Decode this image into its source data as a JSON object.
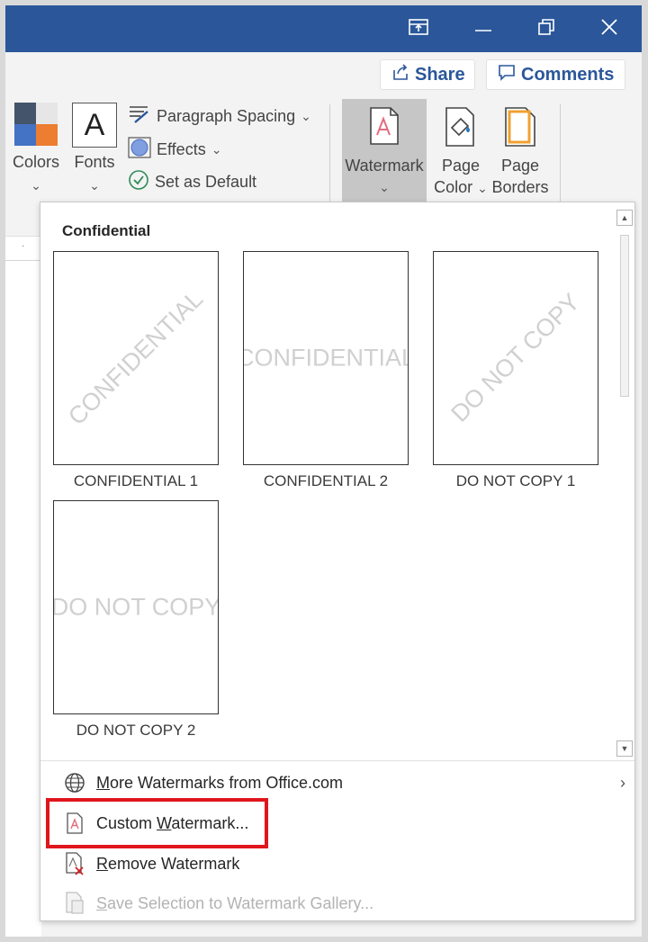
{
  "titlebar": {
    "bg": "#2b579a",
    "icons": [
      "ribbon-display-icon",
      "minimize-icon",
      "restore-icon",
      "close-icon"
    ]
  },
  "share": {
    "label": "Share",
    "icon": "share-icon"
  },
  "comments": {
    "label": "Comments",
    "icon": "comment-icon"
  },
  "ribbon": {
    "colors_label": "Colors",
    "fonts_label": "Fonts",
    "fonts_glyph": "A",
    "paragraph_spacing_label": "Paragraph Spacing",
    "effects_label": "Effects",
    "set_default_label": "Set as Default",
    "watermark_label": "Watermark",
    "page_color_label_1": "Page",
    "page_color_label_2": "Color",
    "page_borders_label_1": "Page",
    "page_borders_label_2": "Borders"
  },
  "gallery": {
    "title": "Confidential",
    "items": [
      {
        "label": "CONFIDENTIAL 1",
        "text": "CONFIDENTIAL",
        "style": "diagonal"
      },
      {
        "label": "CONFIDENTIAL 2",
        "text": "CONFIDENTIAL",
        "style": "horizontal"
      },
      {
        "label": "DO NOT COPY 1",
        "text": "DO NOT COPY",
        "style": "diagonal"
      },
      {
        "label": "DO NOT COPY 2",
        "text": "DO NOT COPY",
        "style": "horizontal"
      }
    ]
  },
  "menu": {
    "more_pre": "",
    "more_u": "M",
    "more_post": "ore Watermarks from Office.com",
    "custom_pre": "Custom ",
    "custom_u": "W",
    "custom_post": "atermark...",
    "remove_pre": "",
    "remove_u": "R",
    "remove_post": "emove Watermark",
    "save_pre": "",
    "save_u": "S",
    "save_post": "ave Selection to Watermark Gallery...",
    "highlight_color": "#e0161d"
  }
}
